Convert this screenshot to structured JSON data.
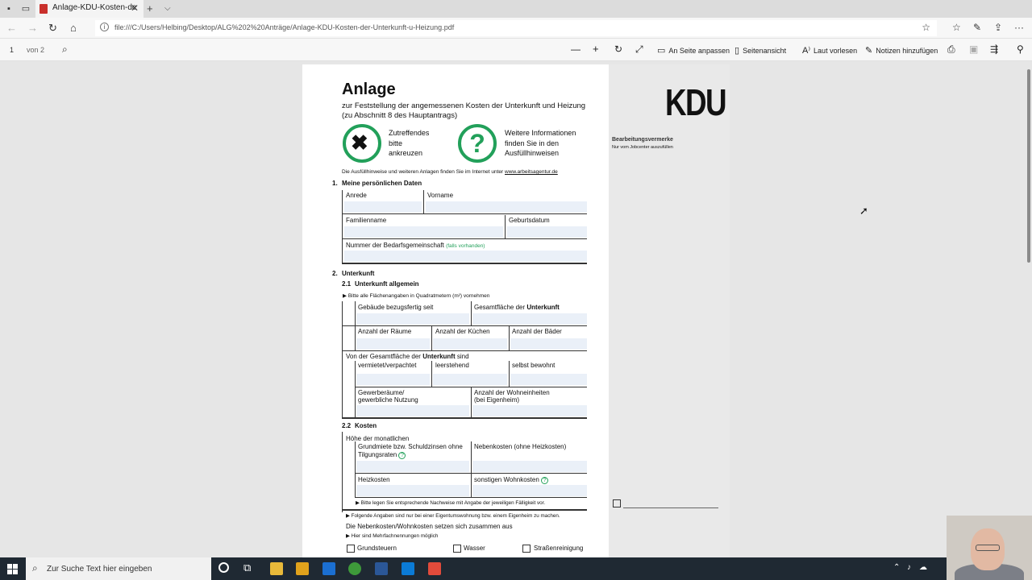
{
  "browser": {
    "tab_title": "Anlage-KDU-Kosten-de",
    "url": "file:///C:/Users/Helbing/Desktop/ALG%202%20Anträge/Anlage-KDU-Kosten-der-Unterkunft-u-Heizung.pdf"
  },
  "pdf_toolbar": {
    "page_number": "1",
    "page_total": "von 2",
    "fit_label": "An Seite anpassen",
    "page_view_label": "Seitenansicht",
    "read_aloud_label": "Laut vorlesen",
    "notes_label": "Notizen hinzufügen"
  },
  "form": {
    "title": "Anlage",
    "subtitle1": "zur Feststellung der angemessenen Kosten der Unterkunft und Heizung",
    "subtitle2": "(zu Abschnitt 8 des Hauptantrags)",
    "hint_check1": "Zutreffendes",
    "hint_check2": "bitte",
    "hint_check3": "ankreuzen",
    "hint_info1": "Weitere Informationen",
    "hint_info2": "finden Sie in den",
    "hint_info3": "Ausfüllhinweisen",
    "hint_line_a": "Die Ausfüllhinweise und weiteren Anlagen finden Sie im Internet unter",
    "hint_line_b": "www.arbeitsagentur.de",
    "kdu": "KDU",
    "bearbeitung": "Bearbeitungsvermerke",
    "bearbeitung_sub": "Nur vom Jobcenter auszufüllen",
    "s1": "1.",
    "s1_title": "Meine persönlichen Daten",
    "anrede": "Anrede",
    "vorname": "Vorname",
    "familienname": "Familienname",
    "geburtsdatum": "Geburtsdatum",
    "bg_nummer": "Nummer der Bedarfsgemeinschaft",
    "bg_nummer_hint": "(falls vorhanden)",
    "s2": "2.",
    "s2_title": "Unterkunft",
    "s21": "2.1",
    "s21_title": "Unterkunft allgemein",
    "flaechen_hint": "Bitte alle Flächenangaben in Quadratmetern (m²) vornehmen",
    "bezugsfertig": "Gebäude bezugsfertig seit",
    "gesamtflaeche_a": "Gesamtfläche der",
    "gesamtflaeche_b": "Unterkunft",
    "raeume": "Anzahl der Räume",
    "kuechen": "Anzahl der Küchen",
    "baeder": "Anzahl der Bäder",
    "von_der_a": "Von der Gesamtfläche der",
    "von_der_b": "Unterkunft",
    "von_der_c": "sind",
    "vermietet": "vermietet/verpachtet",
    "leerstehend": "leerstehend",
    "selbst": "selbst bewohnt",
    "gewerbe1": "Gewerberäume/",
    "gewerbe2": "gewerbliche Nutzung",
    "wohneinheiten1": "Anzahl der Wohneinheiten",
    "wohneinheiten2": "(bei Eigenheim)",
    "s22": "2.2",
    "s22_title": "Kosten",
    "hoehe": "Höhe der monatlichen",
    "grundmiete1": "Grundmiete bzw. Schuldzinsen ohne",
    "grundmiete2": "Tilgungsraten",
    "nebenkosten": "Nebenkosten (ohne Heizkosten)",
    "heizkosten": "Heizkosten",
    "sonstige": "sonstigen Wohnkosten",
    "nachweise": "Bitte legen Sie entsprechende Nachweise mit Angabe der jeweiligen Fälligkeit vor.",
    "eigentum": "Folgende Angaben sind nur bei einer Eigentumswohnung bzw. einem Eigenheim zu machen.",
    "nebenkosten_setzen": "Die Nebenkosten/Wohnkosten setzen sich zusammen aus",
    "mehrfach": "Hier sind Mehrfachnennungen möglich",
    "grundsteuern": "Grundsteuern",
    "wasser": "Wasser",
    "strassen": "Straßenreinigung"
  },
  "taskbar": {
    "search_placeholder": "Zur Suche Text hier eingeben"
  }
}
